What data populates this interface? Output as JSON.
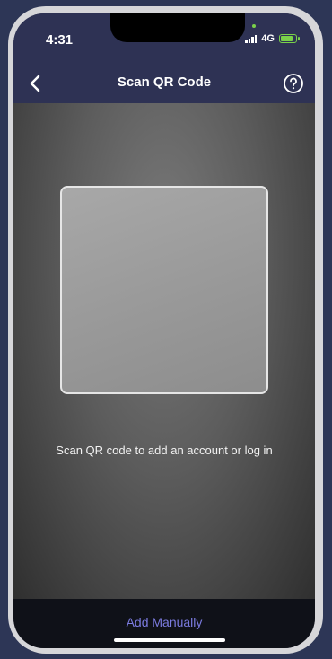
{
  "status_bar": {
    "time": "4:31",
    "network": "4G",
    "battery_level": 0.85,
    "battery_color": "#7ad14a"
  },
  "nav": {
    "back_icon": "chevron-left-icon",
    "title": "Scan QR Code",
    "help_icon": "question-circle-icon"
  },
  "scanner": {
    "hint": "Scan QR code to add an account or log in"
  },
  "bottom": {
    "add_manually_label": "Add Manually",
    "accent_color": "#7b7be0"
  },
  "colors": {
    "header_bg": "#2e3254",
    "page_bg": "#2d3656"
  }
}
